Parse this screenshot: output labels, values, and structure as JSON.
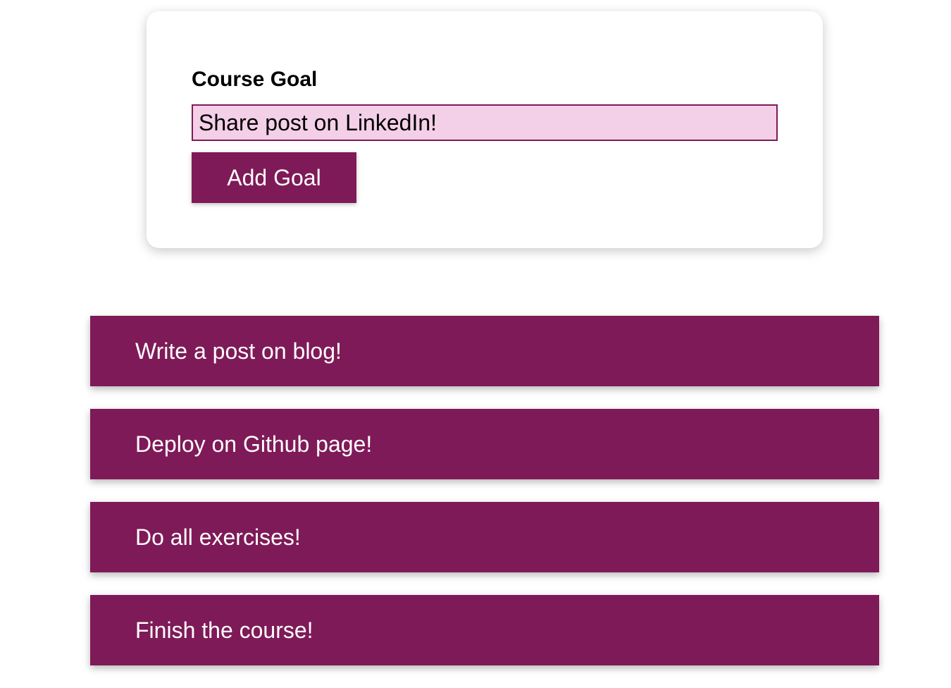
{
  "form": {
    "label": "Course Goal",
    "input_value": "Share post on LinkedIn!",
    "submit_label": "Add Goal"
  },
  "goals": [
    "Write a post on blog!",
    "Deploy on Github page!",
    "Do all exercises!",
    "Finish the course!"
  ],
  "colors": {
    "accent": "#7f1a58",
    "input_background": "#f4d0e8"
  }
}
